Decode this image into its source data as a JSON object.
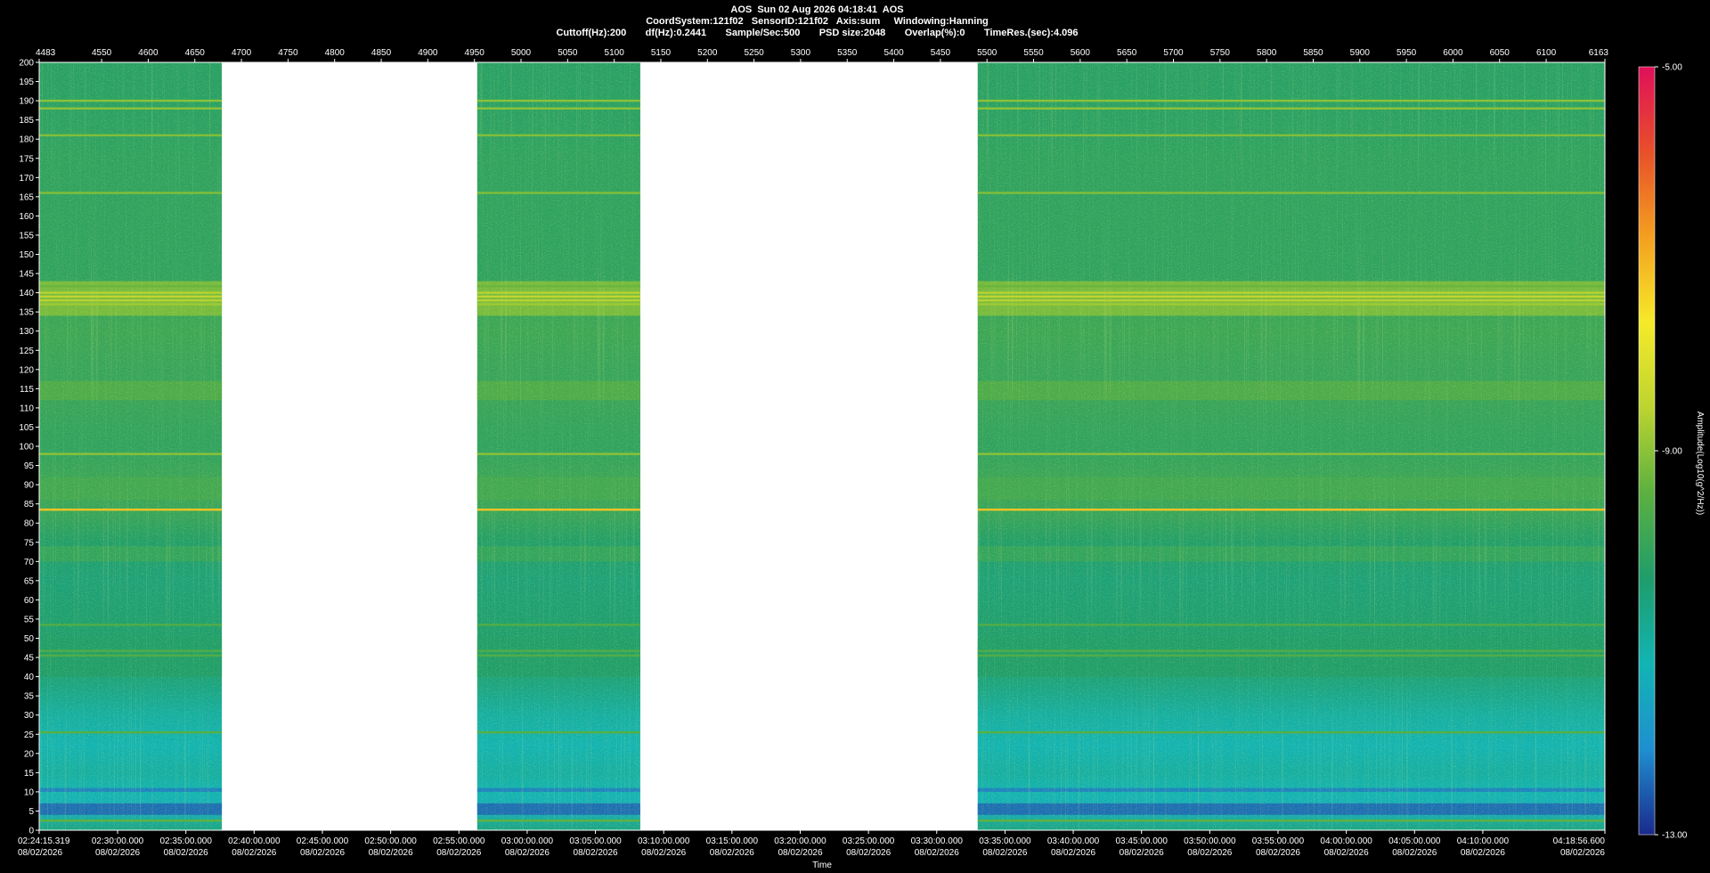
{
  "header": {
    "title": "AOS  Sun 02 Aug 2026 04:18:41  AOS",
    "line2": "CoordSystem:121f02   SensorID:121f02   Axis:sum     Windowing:Hanning",
    "line3": "Cuttoff(Hz):200       df(Hz):0.2441       Sample/Sec:500       PSD size:2048       Overlap(%):0       TimeRes.(sec):4.096"
  },
  "chart_data": {
    "type": "heatmap",
    "xlabel": "Time",
    "ylabel": "",
    "colorbar_label": "Amplitude(Log10(g^2/Hz))",
    "ylim": [
      0,
      200
    ],
    "y_ticks": [
      0,
      5,
      10,
      15,
      20,
      25,
      30,
      35,
      40,
      45,
      50,
      55,
      60,
      65,
      70,
      75,
      80,
      85,
      90,
      95,
      100,
      105,
      110,
      115,
      120,
      125,
      130,
      135,
      140,
      145,
      150,
      155,
      160,
      165,
      170,
      175,
      180,
      185,
      190,
      195,
      200
    ],
    "top_axis": {
      "range": [
        4483,
        6163
      ],
      "ticks": [
        4483,
        4550,
        4600,
        4650,
        4700,
        4750,
        4800,
        4850,
        4900,
        4950,
        5000,
        5050,
        5100,
        5150,
        5200,
        5250,
        5300,
        5350,
        5400,
        5450,
        5500,
        5550,
        5600,
        5650,
        5700,
        5750,
        5800,
        5850,
        5900,
        5950,
        6000,
        6050,
        6100,
        6163
      ]
    },
    "time_range": [
      "02:24:15.319",
      "04:18:56.600"
    ],
    "date_label": "08/02/2026",
    "time_ticks": [
      "02:24:15.319",
      "02:30:00.000",
      "02:35:00.000",
      "02:40:00.000",
      "02:45:00.000",
      "02:50:00.000",
      "02:55:00.000",
      "03:00:00.000",
      "03:05:00.000",
      "03:10:00.000",
      "03:15:00.000",
      "03:20:00.000",
      "03:25:00.000",
      "03:30:00.000",
      "03:35:00.000",
      "03:40:00.000",
      "03:45:00.000",
      "03:50:00.000",
      "03:55:00.000",
      "04:00:00.000",
      "04:05:00.000",
      "04:10:00.000",
      "04:18:56.600"
    ],
    "data_segments": [
      {
        "start": 4483,
        "end": 4679
      },
      {
        "start": 4953,
        "end": 5128
      },
      {
        "start": 5490,
        "end": 6163
      }
    ],
    "strong_frequency_lines_hz": [
      {
        "hz": 190,
        "level": -9.0
      },
      {
        "hz": 188,
        "level": -9.0
      },
      {
        "hz": 181,
        "level": -9.1
      },
      {
        "hz": 166,
        "level": -9.1
      },
      {
        "hz": 141.7,
        "level": -9.3
      },
      {
        "hz": 140,
        "level": -8.6
      },
      {
        "hz": 139,
        "level": -8.5
      },
      {
        "hz": 138,
        "level": -8.6
      },
      {
        "hz": 137,
        "level": -8.8
      },
      {
        "hz": 98,
        "level": -9.0
      },
      {
        "hz": 83.5,
        "level": -7.2
      },
      {
        "hz": 53.5,
        "level": -9.6
      },
      {
        "hz": 46.7,
        "level": -9.6
      },
      {
        "hz": 45.5,
        "level": -9.6
      },
      {
        "hz": 25.5,
        "level": -9.5
      },
      {
        "hz": 2.5,
        "level": -9.4
      }
    ],
    "broad_bands_hz": [
      {
        "from": 134,
        "to": 143,
        "level": -9.1
      },
      {
        "from": 112,
        "to": 117,
        "level": -9.6
      },
      {
        "from": 86,
        "to": 92,
        "level": -9.8
      },
      {
        "from": 70,
        "to": 74,
        "level": -10.0
      },
      {
        "from": 40,
        "to": 50,
        "level": -10.3
      },
      {
        "from": 10,
        "to": 11,
        "level": -12.3
      },
      {
        "from": 4,
        "to": 7,
        "level": -12.5
      }
    ],
    "colorbar": {
      "min": -13.0,
      "max": -5.0,
      "tick_labels": [
        "-5.00",
        "-9.00",
        "-13.00"
      ],
      "tick_values": [
        -5,
        -9,
        -13
      ],
      "colors": [
        "#1a2a8c",
        "#1f8fd0",
        "#12b4b4",
        "#1f9d6b",
        "#5bb040",
        "#bcd430",
        "#f6ea2a",
        "#f4a020",
        "#e8502a",
        "#e0105a"
      ]
    }
  }
}
